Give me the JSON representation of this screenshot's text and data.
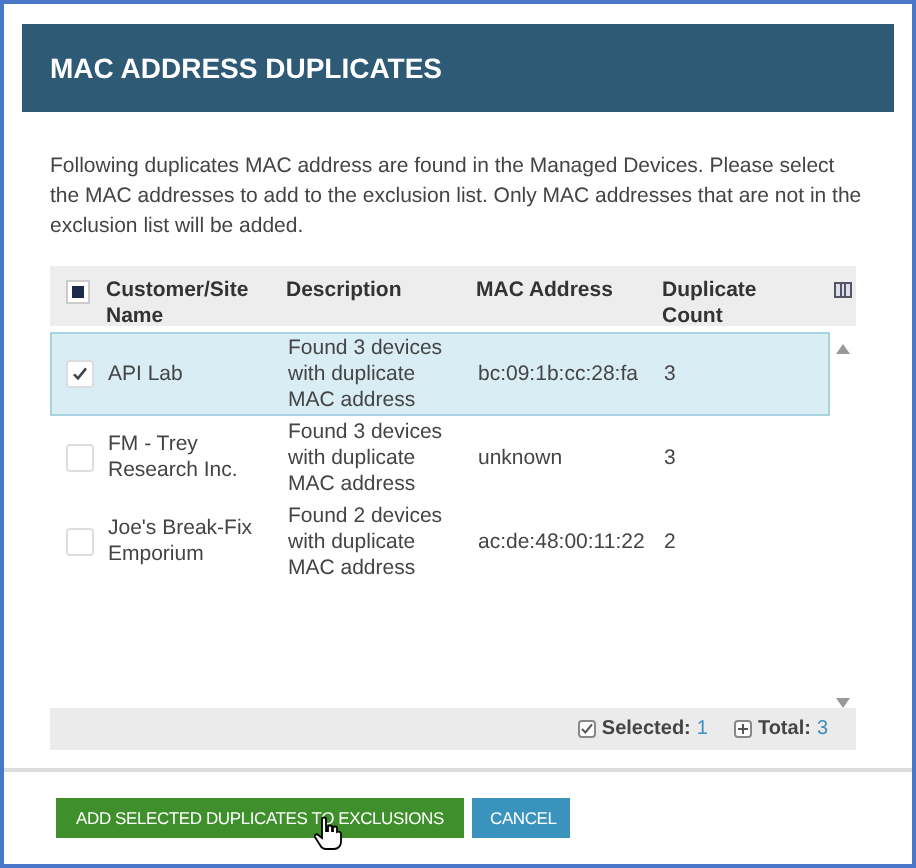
{
  "dialog": {
    "title": "MAC ADDRESS DUPLICATES",
    "message": "Following duplicates MAC address are found in the Managed Devices. Please select the MAC addresses to add to the exclusion list. Only MAC addresses that are not in the exclusion list will be added."
  },
  "table": {
    "select_all_partial": true,
    "columns": [
      "Customer/Site Name",
      "Description",
      "MAC Address",
      "Duplicate Count"
    ],
    "rows": [
      {
        "selected": true,
        "cells": [
          "API Lab",
          "Found 3 devices with duplicate MAC address",
          "bc:09:1b:cc:28:fa",
          "3"
        ]
      },
      {
        "selected": false,
        "cells": [
          "FM - Trey Research Inc.",
          "Found 3 devices with duplicate MAC address",
          "unknown",
          "3"
        ]
      },
      {
        "selected": false,
        "cells": [
          "Joe's Break-Fix Emporium",
          "Found 2 devices with duplicate MAC address",
          "ac:de:48:00:11:22",
          "2"
        ]
      }
    ]
  },
  "footer": {
    "selected_label": "Selected:",
    "selected_count": "1",
    "total_label": "Total:",
    "total_count": "3"
  },
  "buttons": [
    {
      "kind": "primary",
      "label": "ADD SELECTED DUPLICATES TO EXCLUSIONS"
    },
    {
      "kind": "secondary",
      "label": "CANCEL"
    }
  ]
}
